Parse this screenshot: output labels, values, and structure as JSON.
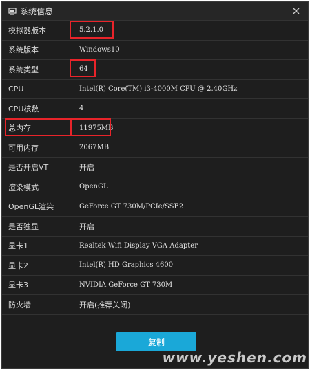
{
  "window": {
    "title": "系统信息",
    "close_glyph": "×"
  },
  "rows": [
    {
      "label": "模拟器版本",
      "value": "5.2.1.0"
    },
    {
      "label": "系统版本",
      "value": "Windows10"
    },
    {
      "label": "系统类型",
      "value": "64"
    },
    {
      "label": "CPU",
      "value": "Intel(R) Core(TM) i3-4000M CPU @ 2.40GHz"
    },
    {
      "label": "CPU核数",
      "value": "4"
    },
    {
      "label": "总内存",
      "value": "11975MB"
    },
    {
      "label": "可用内存",
      "value": "2067MB"
    },
    {
      "label": "是否开启VT",
      "value": "开启"
    },
    {
      "label": "渲染模式",
      "value": "OpenGL"
    },
    {
      "label": "OpenGL渲染",
      "value": "GeForce GT 730M/PCIe/SSE2"
    },
    {
      "label": "是否独显",
      "value": "开启"
    },
    {
      "label": "显卡1",
      "value": "Realtek Wifi Display VGA Adapter"
    },
    {
      "label": "显卡2",
      "value": "Intel(R) HD Graphics 4600"
    },
    {
      "label": "显卡3",
      "value": "NVIDIA GeForce GT 730M"
    },
    {
      "label": "防火墙",
      "value": "开启(推荐关闭)"
    }
  ],
  "footer": {
    "copy_label": "复制"
  },
  "watermark": "www.yeshen.com",
  "colors": {
    "highlight": "#e8242a",
    "button": "#1aa8d8",
    "background": "#1e1e1e"
  }
}
